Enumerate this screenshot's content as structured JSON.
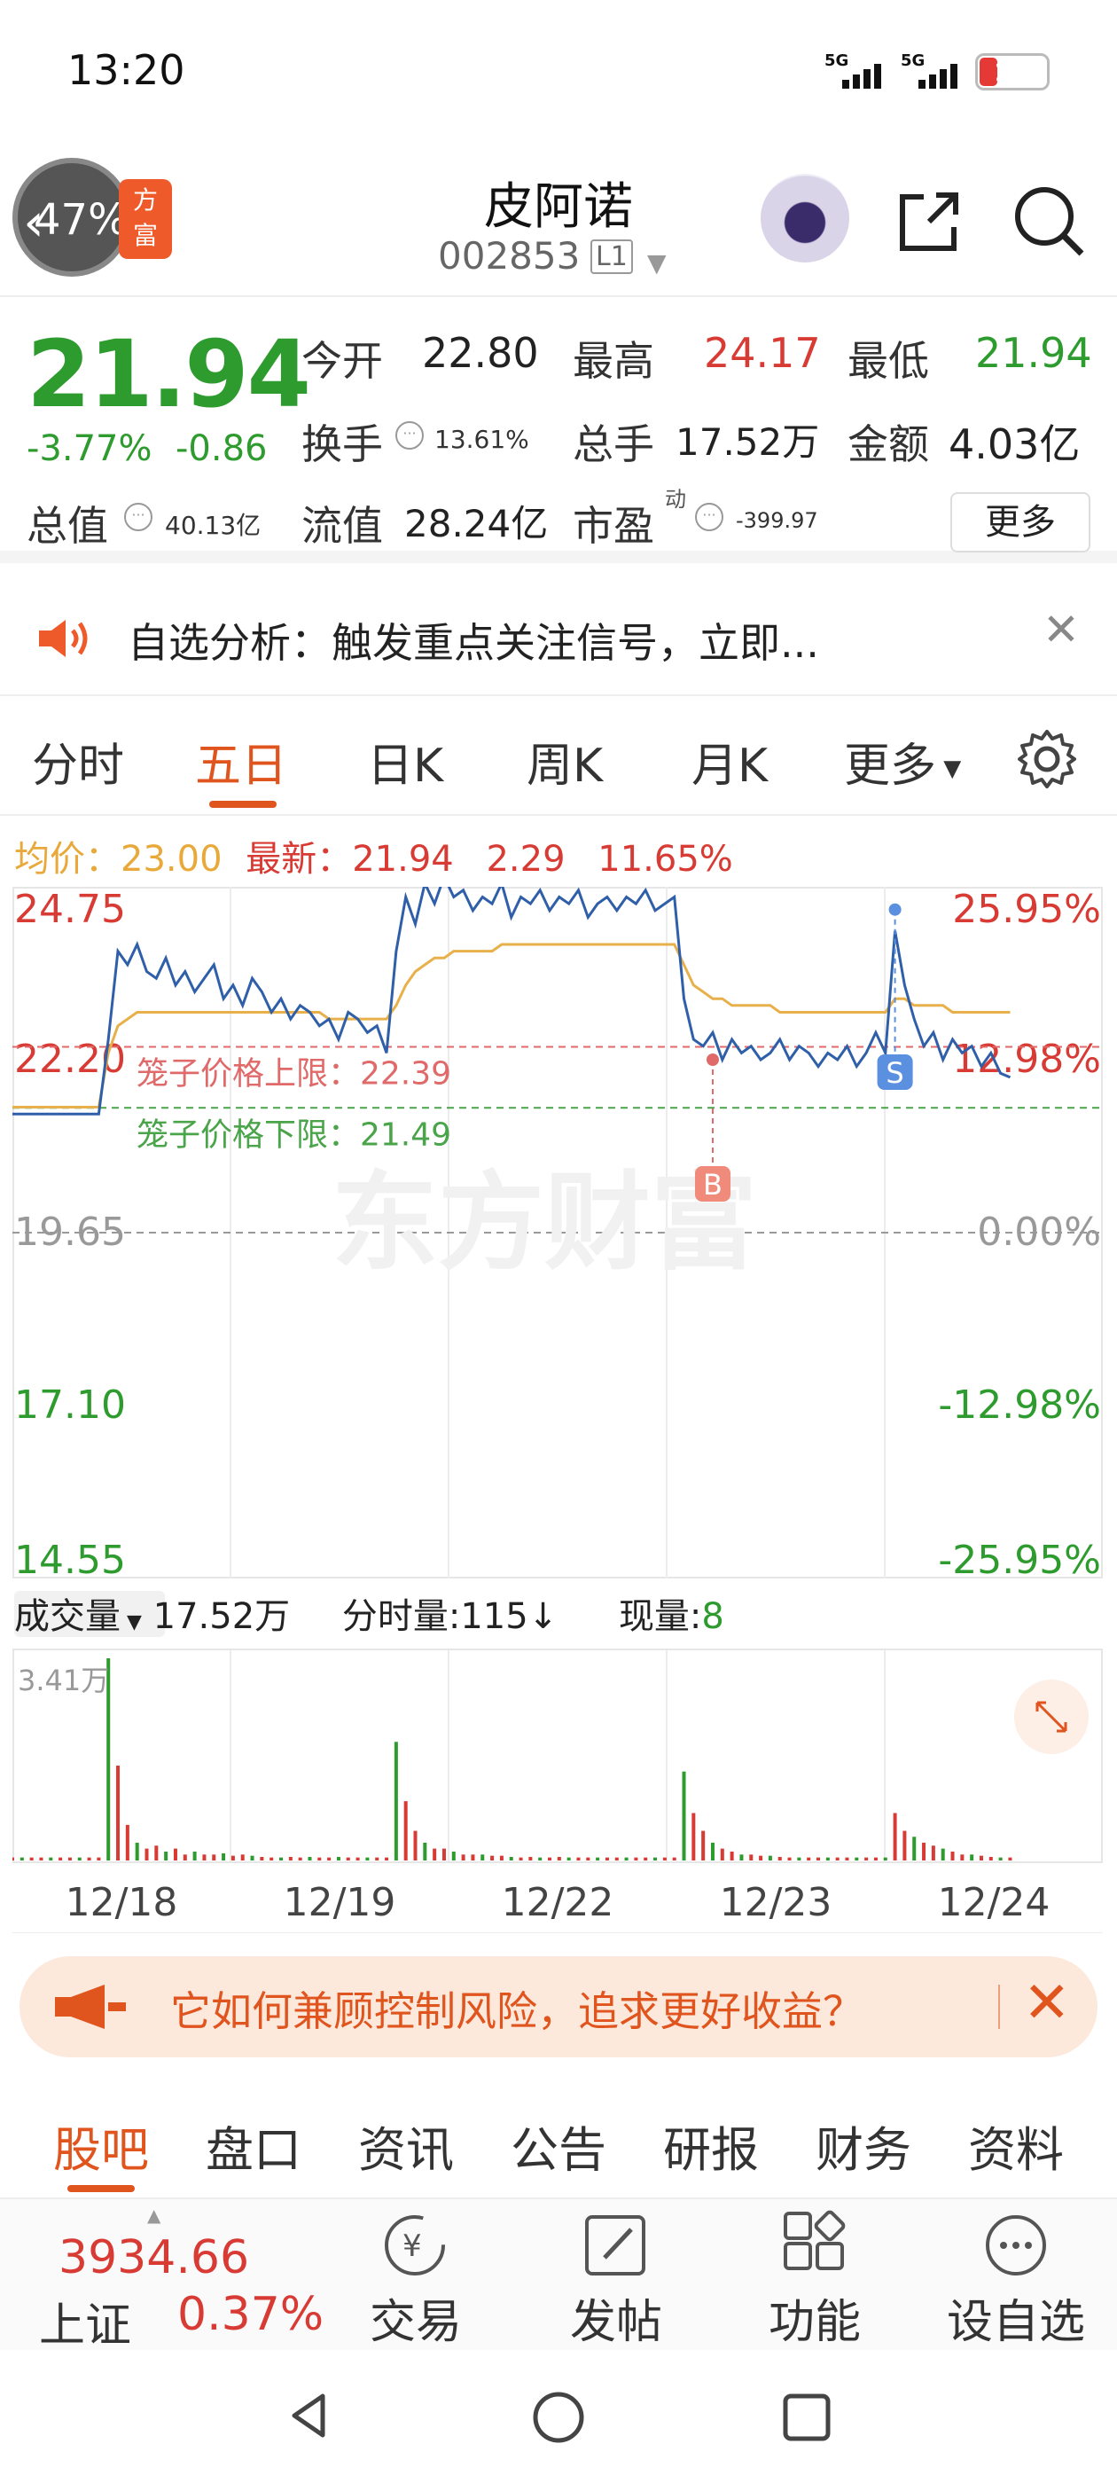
{
  "status_bar": {
    "time": "13:20",
    "net1": "5G",
    "net2": "5G",
    "battery": "18"
  },
  "header": {
    "progress": "47%",
    "badge": "方\n富",
    "name": "皮阿诺",
    "code": "002853",
    "level": "L1"
  },
  "quote": {
    "price": "21.94",
    "pct": "-3.77%",
    "change": "-0.86",
    "open_label": "今开",
    "open": "22.80",
    "high_label": "最高",
    "high": "24.17",
    "low_label": "最低",
    "low": "21.94",
    "turnover_label": "换手",
    "turnover": "13.61%",
    "volume_label": "总手",
    "volume": "17.52万",
    "amount_label": "金额",
    "amount": "4.03亿",
    "mktcap_label": "总值",
    "mktcap": "40.13亿",
    "float_label": "流值",
    "float": "28.24亿",
    "pe_label": "市盈",
    "pe_sup": "动",
    "pe": "-399.97",
    "more": "更多"
  },
  "notice": {
    "text": "自选分析：触发重点关注信号，立即..."
  },
  "chart_tabs": [
    "分时",
    "五日",
    "日K",
    "周K",
    "月K",
    "更多"
  ],
  "chart_header": {
    "avg_label": "均价：",
    "avg": "23.00",
    "latest_label": "最新：",
    "latest": "21.94",
    "change": "2.29",
    "change_pct": "11.65%"
  },
  "chart_data": {
    "type": "line",
    "x_labels": [
      "12/18",
      "12/19",
      "12/22",
      "12/23",
      "12/24"
    ],
    "y_ticks": [
      "24.75",
      "22.20",
      "19.65",
      "17.10",
      "14.55"
    ],
    "y_ticks_pct": [
      "25.95%",
      "12.98%",
      "0.00%",
      "-12.98%",
      "-25.95%"
    ],
    "ylim": [
      14.55,
      24.75
    ],
    "cage_upper_label": "笼子价格上限：22.39",
    "cage_lower_label": "笼子价格下限：21.49",
    "cage_upper": 22.39,
    "cage_lower": 21.49,
    "prev_close": 19.65,
    "watermark": "东方财富",
    "series": [
      {
        "values": [
          21.4,
          21.4,
          21.4,
          21.4,
          21.4,
          21.4,
          21.4,
          21.4,
          21.4,
          21.4,
          22.5,
          23.8,
          23.6,
          23.9,
          23.5,
          23.4,
          23.7,
          23.3,
          23.5,
          23.2,
          23.4,
          23.6,
          23.1,
          23.3,
          23.0,
          23.4,
          23.2,
          22.9,
          23.1,
          22.8,
          23.0,
          22.9,
          22.7,
          22.8,
          22.5,
          22.9,
          22.8,
          22.6,
          22.7,
          22.3,
          23.8,
          24.6,
          24.2,
          24.8,
          24.5,
          24.9,
          24.6,
          24.7,
          24.4,
          24.6,
          24.5,
          24.8,
          24.3,
          24.6,
          24.5,
          24.7,
          24.4,
          24.6,
          24.5,
          24.7,
          24.3,
          24.5,
          24.6,
          24.4,
          24.6,
          24.5,
          24.7,
          24.4,
          24.5,
          24.6,
          23.1,
          22.5,
          22.4,
          22.6,
          22.2,
          22.5,
          22.3,
          22.4,
          22.2,
          22.3,
          22.5,
          22.2,
          22.4,
          22.3,
          22.1,
          22.3,
          22.2,
          22.4,
          22.1,
          22.3,
          22.6,
          22.3,
          24.1,
          23.3,
          22.8,
          22.4,
          22.6,
          22.2,
          22.5,
          22.3,
          22.4,
          22.1,
          22.3,
          22.0,
          21.94
        ]
      },
      {
        "values": [
          21.5,
          21.5,
          21.5,
          21.5,
          21.5,
          21.5,
          21.5,
          21.5,
          21.5,
          21.5,
          22.3,
          22.7,
          22.8,
          22.9,
          22.9,
          22.9,
          22.9,
          22.9,
          22.9,
          22.9,
          22.9,
          22.9,
          22.9,
          22.9,
          22.9,
          22.9,
          22.9,
          22.9,
          22.9,
          22.9,
          22.9,
          22.9,
          22.9,
          22.8,
          22.8,
          22.8,
          22.8,
          22.8,
          22.8,
          22.8,
          23.0,
          23.3,
          23.5,
          23.6,
          23.7,
          23.7,
          23.8,
          23.8,
          23.8,
          23.8,
          23.8,
          23.9,
          23.9,
          23.9,
          23.9,
          23.9,
          23.9,
          23.9,
          23.9,
          23.9,
          23.9,
          23.9,
          23.9,
          23.9,
          23.9,
          23.9,
          23.9,
          23.9,
          23.9,
          23.9,
          23.6,
          23.3,
          23.2,
          23.1,
          23.1,
          23.0,
          23.0,
          23.0,
          23.0,
          23.0,
          22.9,
          22.9,
          22.9,
          22.9,
          22.9,
          22.9,
          22.9,
          22.9,
          22.9,
          22.9,
          22.9,
          22.9,
          23.1,
          23.1,
          23.0,
          23.0,
          23.0,
          23.0,
          22.9,
          22.9,
          22.9,
          22.9,
          22.9,
          22.9,
          22.9
        ]
      }
    ],
    "markers": [
      {
        "label": "B",
        "value": 22.2,
        "index": 73
      },
      {
        "label": "S",
        "value": 24.1,
        "index": 92
      }
    ],
    "colors": {
      "price": "#2f5fa8",
      "avg": "#e8b04a",
      "up": "#d83a34",
      "down": "#2e9b2e",
      "upper": "#e06a6a",
      "lower": "#4aa44a"
    }
  },
  "volume": {
    "label": "成交量",
    "total": "17.52万",
    "tick_label": "分时量:115",
    "tick_arrow": "↓",
    "now_label": "现量:",
    "now": "8",
    "max_label": "3.41万"
  },
  "volume_data": {
    "values": [
      0.05,
      0.05,
      0.05,
      0.05,
      0.05,
      0.05,
      0.05,
      0.05,
      0.05,
      0.05,
      3.41,
      1.6,
      0.6,
      0.3,
      0.2,
      0.25,
      0.15,
      0.2,
      0.1,
      0.15,
      0.1,
      0.1,
      0.12,
      0.08,
      0.1,
      0.08,
      0.06,
      0.05,
      0.05,
      0.06,
      0.05,
      0.06,
      0.05,
      0.05,
      0.06,
      0.05,
      0.05,
      0.05,
      0.05,
      0.05,
      2.0,
      1.0,
      0.5,
      0.3,
      0.2,
      0.2,
      0.15,
      0.1,
      0.1,
      0.1,
      0.08,
      0.08,
      0.06,
      0.05,
      0.06,
      0.05,
      0.05,
      0.06,
      0.05,
      0.05,
      0.05,
      0.05,
      0.05,
      0.05,
      0.05,
      0.05,
      0.05,
      0.05,
      0.05,
      0.05,
      1.5,
      0.8,
      0.5,
      0.3,
      0.2,
      0.15,
      0.1,
      0.1,
      0.08,
      0.08,
      0.06,
      0.05,
      0.05,
      0.05,
      0.05,
      0.05,
      0.05,
      0.05,
      0.05,
      0.05,
      0.05,
      0.05,
      0.8,
      0.5,
      0.4,
      0.3,
      0.25,
      0.2,
      0.15,
      0.1,
      0.1,
      0.08,
      0.06,
      0.05,
      0.05
    ]
  },
  "promo": {
    "text": "它如何兼顾控制风险，追求更好收益？"
  },
  "section_tabs": [
    "股吧",
    "盘口",
    "资讯",
    "公告",
    "研报",
    "财务",
    "资料"
  ],
  "bottom_bar": {
    "index_value": "3934.66",
    "index_name": "上证",
    "index_pct": "0.37%",
    "items": [
      "交易",
      "发帖",
      "功能",
      "设自选"
    ]
  }
}
